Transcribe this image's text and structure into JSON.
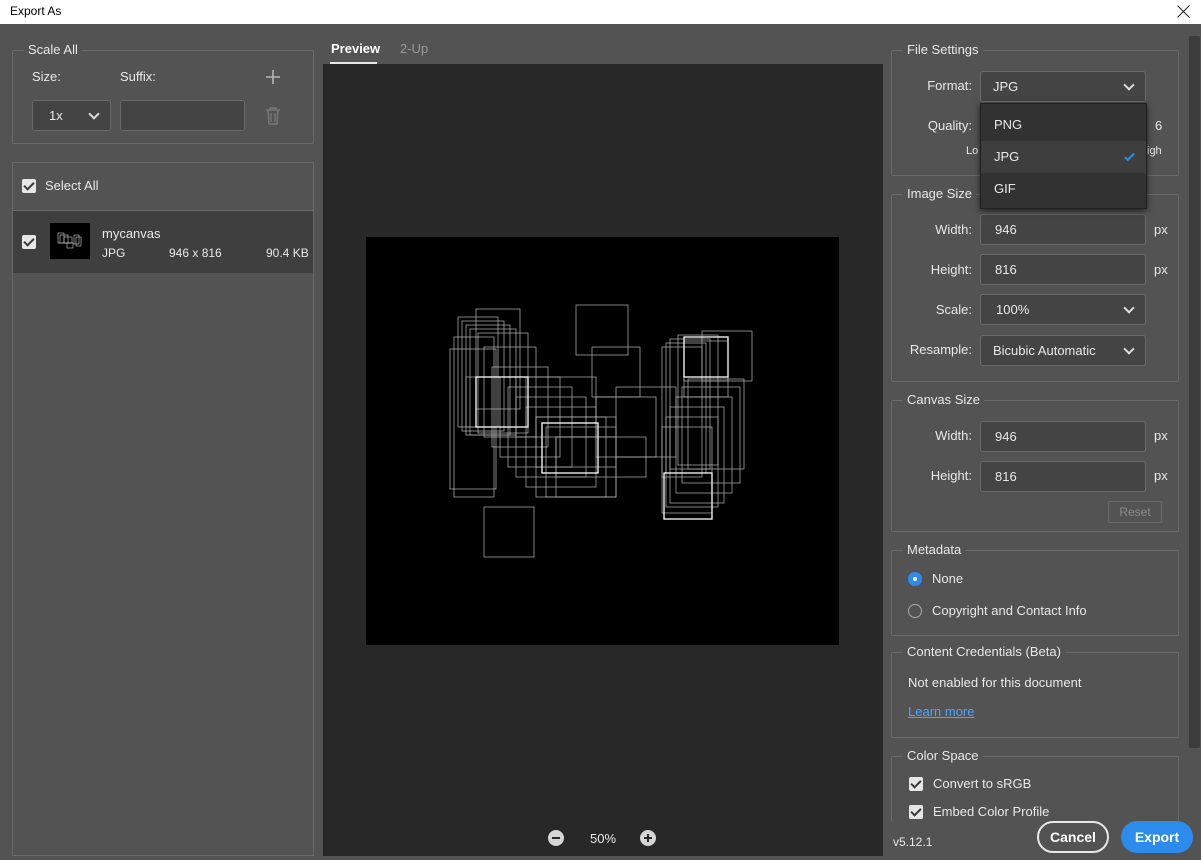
{
  "window": {
    "title": "Export As"
  },
  "scale_all": {
    "group_label": "Scale All",
    "size_label": "Size:",
    "suffix_label": "Suffix:",
    "size_value": "1x",
    "suffix_value": ""
  },
  "assets": {
    "select_all_label": "Select All",
    "items": [
      {
        "name": "mycanvas",
        "format": "JPG",
        "dimensions": "946 x 816",
        "size": "90.4 KB"
      }
    ]
  },
  "tabs": [
    {
      "label": "Preview"
    },
    {
      "label": "2-Up"
    }
  ],
  "zoom": {
    "value": "50%"
  },
  "file_settings": {
    "group_label": "File Settings",
    "format_label": "Format:",
    "format_value": "JPG",
    "quality_label": "Quality:",
    "quality_value_partial": "6",
    "quality_low_partial": "Lo",
    "quality_high_partial": "igh",
    "format_options": [
      "PNG",
      "JPG",
      "GIF"
    ],
    "selected_option": "JPG"
  },
  "image_size": {
    "group_label": "Image Size",
    "width_label": "Width:",
    "width_value": "946",
    "height_label": "Height:",
    "height_value": "816",
    "unit": "px",
    "scale_label": "Scale:",
    "scale_value": "100%",
    "resample_label": "Resample:",
    "resample_value": "Bicubic Automatic"
  },
  "canvas_size": {
    "group_label": "Canvas Size",
    "width_label": "Width:",
    "width_value": "946",
    "height_label": "Height:",
    "height_value": "816",
    "unit": "px",
    "reset_label": "Reset"
  },
  "metadata": {
    "group_label": "Metadata",
    "options": [
      {
        "label": "None",
        "selected": true
      },
      {
        "label": "Copyright and Contact Info",
        "selected": false
      }
    ]
  },
  "content_credentials": {
    "group_label": "Content Credentials (Beta)",
    "status_text": "Not enabled for this document",
    "link_text": "Learn more"
  },
  "color_space": {
    "group_label": "Color Space",
    "convert_label": "Convert to sRGB",
    "embed_label": "Embed Color Profile"
  },
  "footer": {
    "version": "v5.12.1",
    "cancel_label": "Cancel",
    "export_label": "Export"
  },
  "colors": {
    "accent": "#2d8ceb",
    "panel_bg": "#535353",
    "preview_bg": "#282828",
    "link": "#4ea1ff"
  },
  "icons": [
    "close-icon",
    "plus-icon",
    "trash-icon",
    "chevron-down-icon",
    "checkmark-icon",
    "zoom-out-icon",
    "zoom-in-icon"
  ]
}
